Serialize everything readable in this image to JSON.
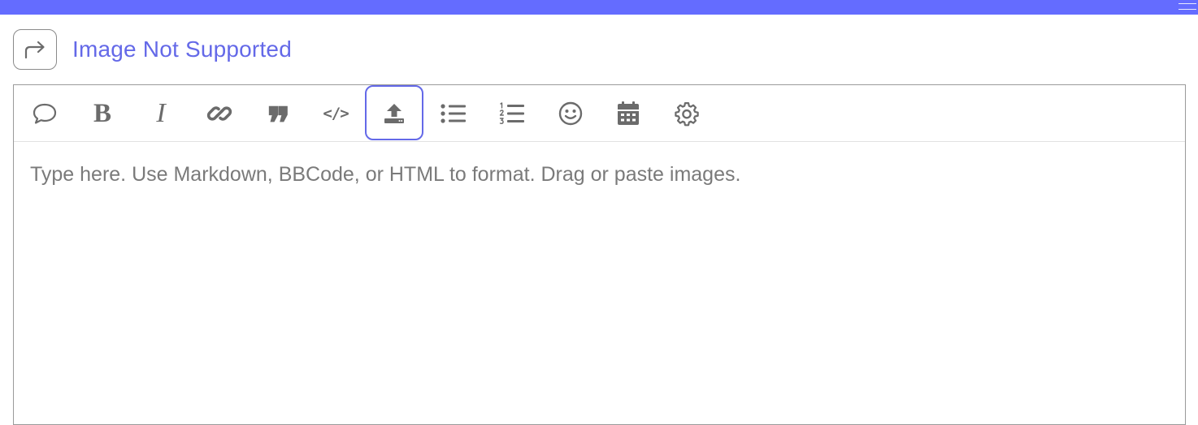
{
  "colors": {
    "accent": "#646cff",
    "title": "#6469e8",
    "icon": "#6b6b6b",
    "border": "#9a9a9a"
  },
  "reply": {
    "icon": "share-forward-icon",
    "title": "Image Not Supported"
  },
  "toolbar": {
    "bold_label": "B",
    "italic_label": "I",
    "quote_label": "❞",
    "code_label": "</>",
    "buttons": [
      {
        "name": "comment",
        "icon": "speech-bubble-icon"
      },
      {
        "name": "bold",
        "icon": "bold-icon"
      },
      {
        "name": "italic",
        "icon": "italic-icon"
      },
      {
        "name": "link",
        "icon": "link-icon"
      },
      {
        "name": "quote",
        "icon": "quote-icon"
      },
      {
        "name": "code",
        "icon": "code-icon"
      },
      {
        "name": "upload",
        "icon": "upload-icon",
        "focused": true
      },
      {
        "name": "bulleted-list",
        "icon": "bulleted-list-icon"
      },
      {
        "name": "numbered-list",
        "icon": "numbered-list-icon"
      },
      {
        "name": "emoji",
        "icon": "smiley-icon"
      },
      {
        "name": "date",
        "icon": "calendar-icon"
      },
      {
        "name": "settings",
        "icon": "gear-icon"
      }
    ]
  },
  "editor": {
    "placeholder": "Type here. Use Markdown, BBCode, or HTML to format. Drag or paste images.",
    "value": ""
  }
}
